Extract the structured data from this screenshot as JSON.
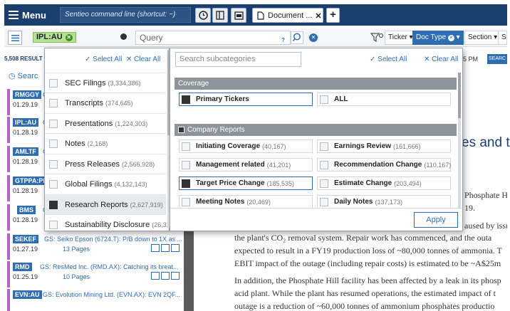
{
  "topbar": {
    "menu_label": "Menu",
    "command_placeholder": "Sentieo command line (shortcut: ~)",
    "doc_tab_label": "Document ...",
    "plus_label": "+"
  },
  "searchbar": {
    "ticker_chip": "IPL:AU",
    "query_placeholder": "Query",
    "help_mark": "?",
    "filters": [
      "Ticker",
      "Doc Type",
      "Section",
      "S"
    ]
  },
  "left_list": {
    "results_count": "5,508 RESULT",
    "search_label": "Searc",
    "items": [
      {
        "ticker": "RMGGY",
        "date": "01.29.19",
        "gs": "G",
        "pages": ""
      },
      {
        "ticker": "IPL:AU",
        "date": "01.28.19",
        "gs": "G",
        "pages": ""
      },
      {
        "ticker": "AMLTF",
        "date": "01.28.19",
        "gs": "G",
        "pages": ""
      },
      {
        "ticker": "GTPPA:PM",
        "date": "01.28.19",
        "gs": "G",
        "pages": ""
      },
      {
        "ticker": "BMS",
        "date": "01.28.19",
        "gs": "G",
        "pages": ""
      },
      {
        "ticker": "SEKEF",
        "date": "01.27.19",
        "gs": "GS: Seiko Epson (6724.T): P/B down to 1X as ...",
        "pages": "13 Pages"
      },
      {
        "ticker": "RMD",
        "date": "01.25.19",
        "gs": "GS: ResMed Inc. (RMD.AX): Catching its breat...",
        "pages": "10 Pages"
      },
      {
        "ticker": "EVN:AU",
        "date": "",
        "gs": "GS: Evolution Mining Ltd. (EVN.AX): EVN 2QF...",
        "pages": ""
      }
    ]
  },
  "doc": {
    "time_frag": "5 PM",
    "search_btn": "SEARC",
    "title_frag": "es and ta",
    "lines": [
      "Phosphate Hil",
      "19.",
      "aused by issu",
      "the plant's CO₂ removal system. Repair work has commenced, and the outa",
      "expected to result in a FY19 production loss of ~80,000 tonnes of ammonia. T",
      "EBIT impact of the outage (including repair costs) is estimated to be ~A$25m",
      "In addition, the Phosphate Hill facility has been affected by a leak in its phosp",
      "acid plant. While the plant has resumed operations, the estimated impact of t",
      "outage is a reduction of ~60,000 tonnes of ammonium phosphates productio"
    ]
  },
  "categories_panel": {
    "select_all": "Select All",
    "clear_all": "Clear All",
    "items": [
      {
        "name": "SEC Filings",
        "count": "(3,334,386)",
        "checked": false
      },
      {
        "name": "Transcripts",
        "count": "(374,645)",
        "checked": false
      },
      {
        "name": "Presentations",
        "count": "(1,224,303)",
        "checked": false
      },
      {
        "name": "Notes",
        "count": "(2,168)",
        "checked": false
      },
      {
        "name": "Press Releases",
        "count": "(2,566,928)",
        "checked": false
      },
      {
        "name": "Global Filings",
        "count": "(4,132,143)",
        "checked": false
      },
      {
        "name": "Research Reports",
        "count": "(2,627,919)",
        "checked": true
      },
      {
        "name": "Sustainability Disclosure",
        "count": "(26,318)",
        "checked": false
      }
    ]
  },
  "subcategories_panel": {
    "search_placeholder": "Search subcategories",
    "select_all": "Select All",
    "clear_all": "Clear All",
    "coverage_title": "Coverage",
    "coverage_options": [
      {
        "name": "Primary Tickers",
        "count": "",
        "checked": true
      },
      {
        "name": "ALL",
        "count": "",
        "checked": false
      }
    ],
    "reports_title": "Company Reports",
    "report_options": [
      {
        "name": "Initiating Coverage",
        "count": "(40,167)",
        "checked": false
      },
      {
        "name": "Earnings Review",
        "count": "(161,666)",
        "checked": false
      },
      {
        "name": "Management related",
        "count": "(41,201)",
        "checked": false
      },
      {
        "name": "Recommendation Change",
        "count": "(110,167)",
        "checked": false
      },
      {
        "name": "Target Price Change",
        "count": "(185,535)",
        "checked": true
      },
      {
        "name": "Estimate Change",
        "count": "(203,494)",
        "checked": false
      },
      {
        "name": "Meeting Notes",
        "count": "(20,469)",
        "checked": false
      },
      {
        "name": "Daily Notes",
        "count": "(137,173)",
        "checked": false
      }
    ],
    "apply_label": "Apply"
  }
}
